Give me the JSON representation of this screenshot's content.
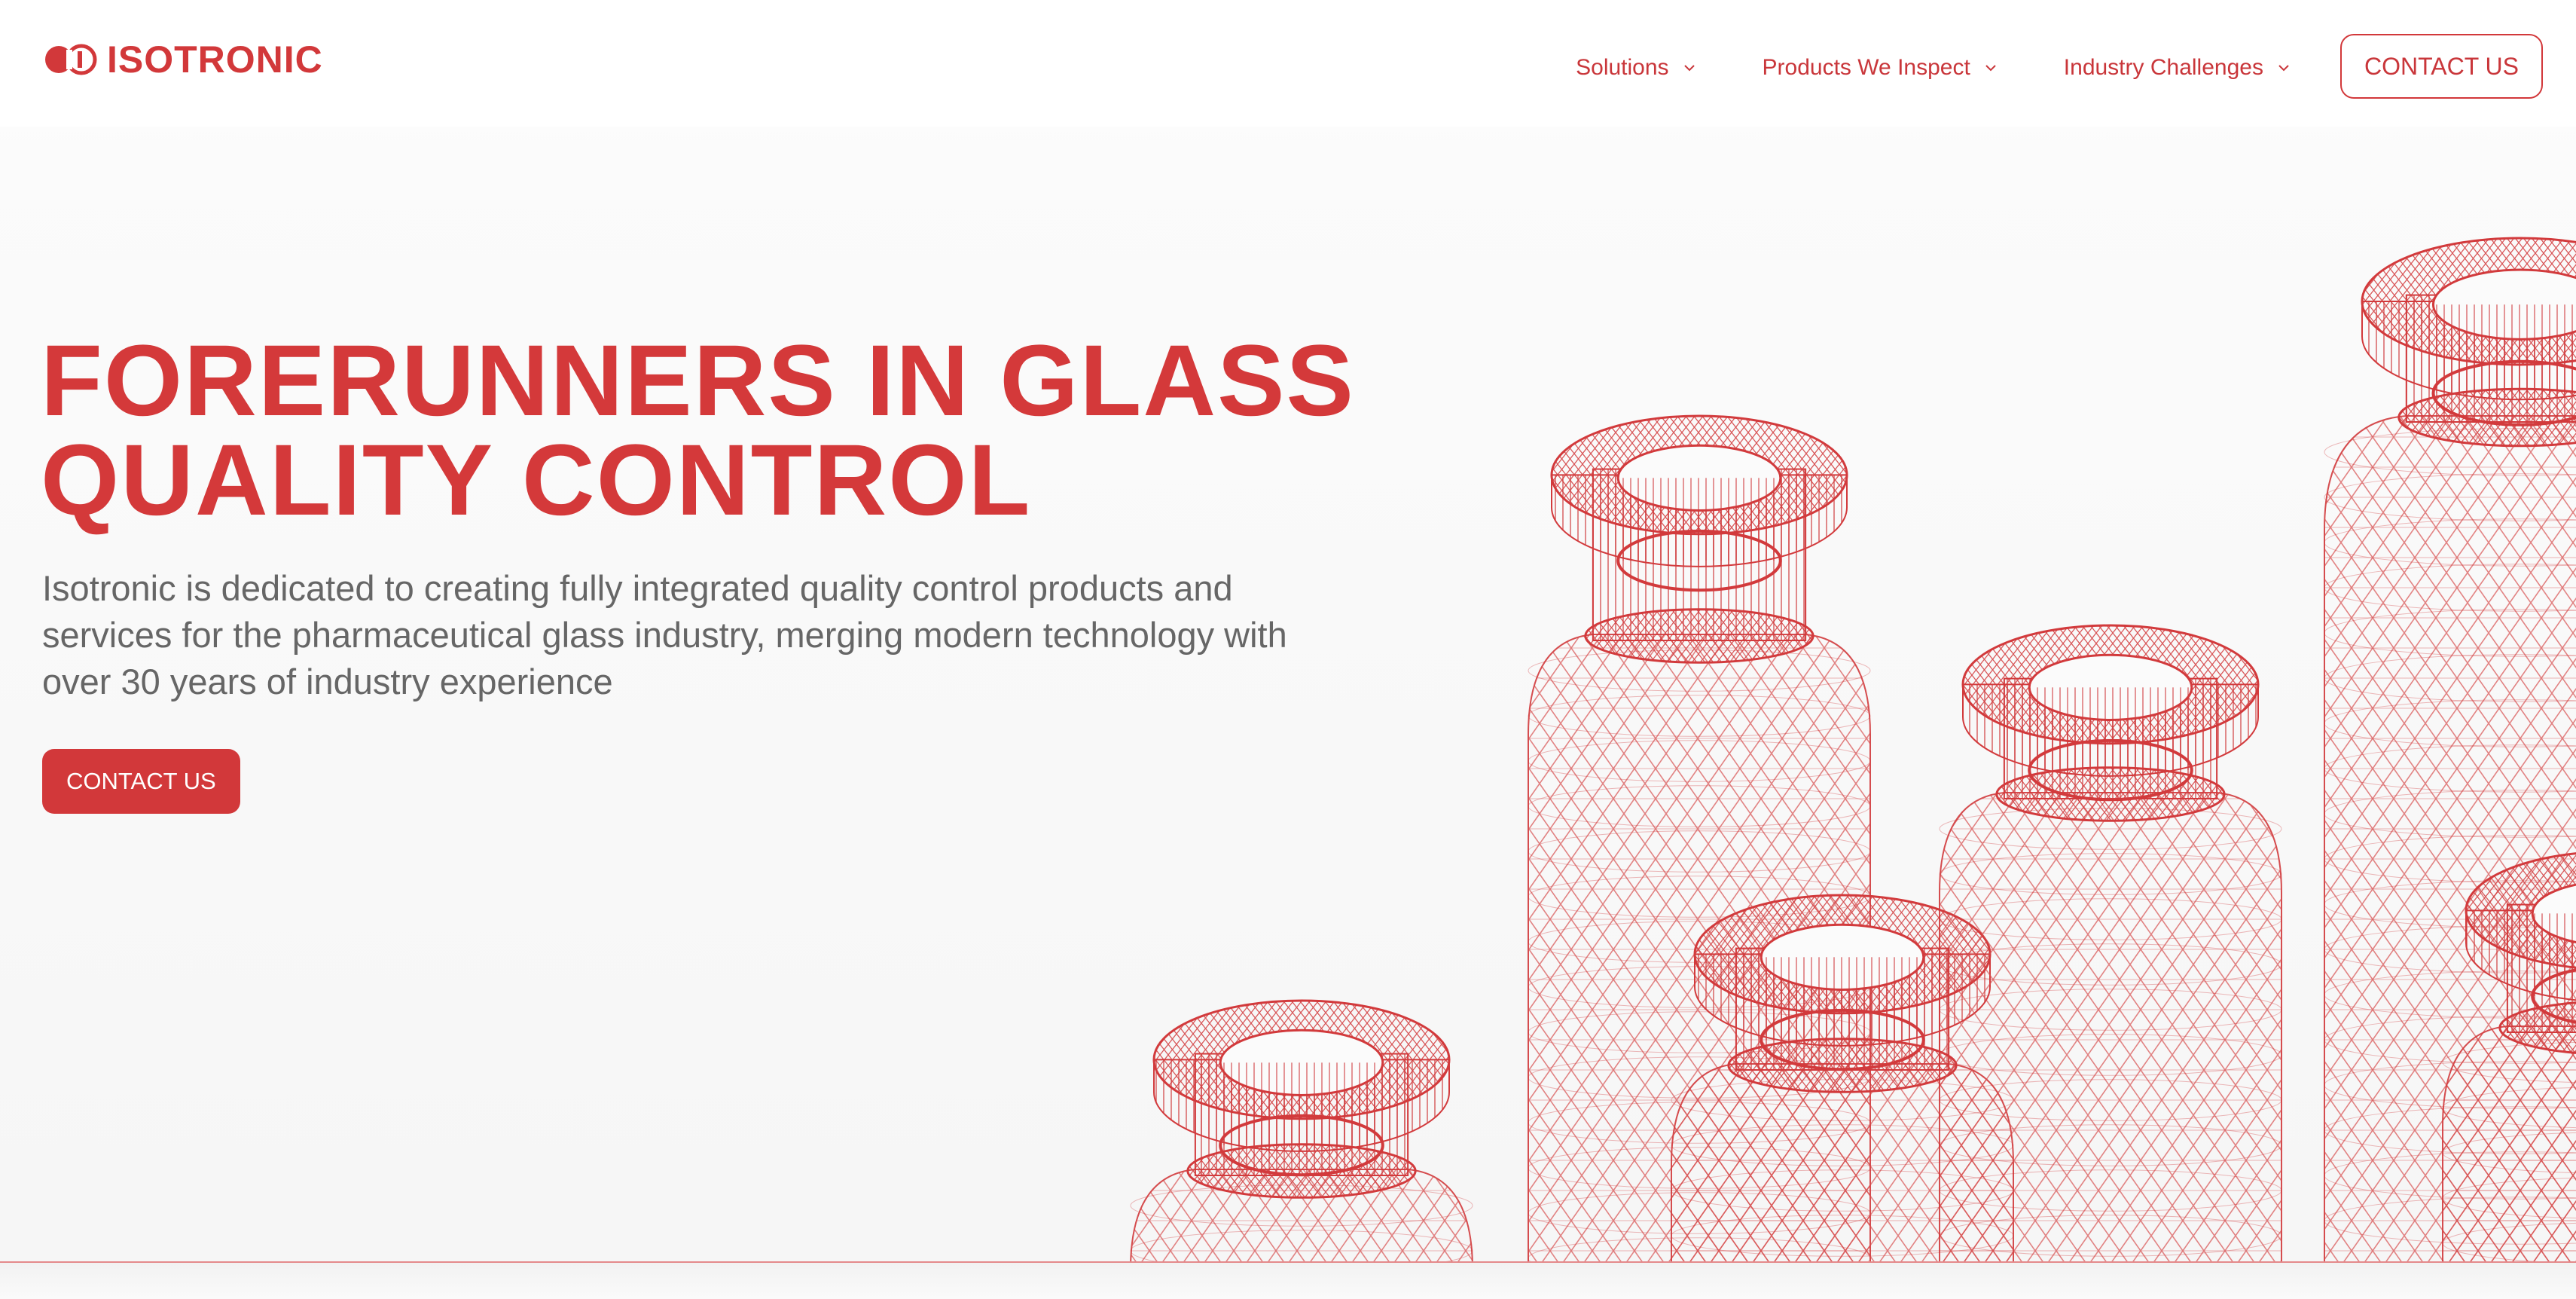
{
  "brand": {
    "name": "ISOTRONIC",
    "logo_icon": "isotronic-logo-mark"
  },
  "nav": {
    "items": [
      {
        "label": "Solutions",
        "icon": "chevron-down-icon"
      },
      {
        "label": "Products We Inspect",
        "icon": "chevron-down-icon"
      },
      {
        "label": "Industry Challenges",
        "icon": "chevron-down-icon"
      }
    ],
    "contact_label": "CONTACT US"
  },
  "hero": {
    "title_line1": "FORERUNNERS IN GLASS",
    "title_line2": "QUALITY CONTROL",
    "description": "Isotronic is dedicated to creating fully integrated quality control products and services for the pharmaceutical glass industry, merging modern technology with over 30 years of industry experience",
    "cta_label": "CONTACT US",
    "illustration": "wireframe-glass-vials"
  },
  "colors": {
    "brand_red": "#d2383a",
    "text_gray": "#666666",
    "background": "#fbfbfb"
  }
}
